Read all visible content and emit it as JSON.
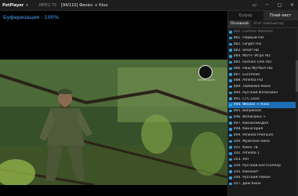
{
  "titlebar": {
    "app_name": "PotPlayer",
    "dropdown_glyph": "▾",
    "format": "MPEG TS",
    "title": "[94/110] Фенікс + Кіно",
    "buttons": [
      "▭",
      "─",
      "□",
      "✕"
    ]
  },
  "video": {
    "buffering": "Буферизация : 100%",
    "channel_logo_text": "ФЕНІКС+КІНО"
  },
  "playlist": {
    "tabs": [
      {
        "label": "Буфер",
        "active": false
      },
      {
        "label": "Плей-лист",
        "active": true
      }
    ],
    "subtabs": [
      {
        "label": "Основной",
        "active": true
      },
      {
        "label": "Этот компьютер",
        "active": false
      }
    ],
    "items": [
      {
        "label": "080. Cartoon Network",
        "state": "dim"
      },
      {
        "label": "081. Первый HD",
        "state": "normal"
      },
      {
        "label": "082. Ginger HD",
        "state": "normal"
      },
      {
        "label": "083. SHOP HD",
        "state": "normal"
      },
      {
        "label": "084. Матч! Игра HD",
        "state": "normal"
      },
      {
        "label": "085. Fashion One HD",
        "state": "normal"
      },
      {
        "label": "086. Наш Футбол HD",
        "state": "normal"
      },
      {
        "label": "087. Euronews",
        "state": "normal"
      },
      {
        "label": "088. Amedia HD",
        "state": "normal"
      },
      {
        "label": "089. Любимое Кино",
        "state": "normal"
      },
      {
        "label": "090. Русский Иллюзион",
        "state": "normal"
      },
      {
        "label": "091. СТС Love",
        "state": "normal"
      },
      {
        "label": "094. Фенікс + Кіно",
        "state": "selected"
      },
      {
        "label": "095. Bollywood",
        "state": "normal"
      },
      {
        "label": "096. Иллюзион +",
        "state": "normal"
      },
      {
        "label": "097. Кинокомедия",
        "state": "normal"
      },
      {
        "label": "098. Киносерия",
        "state": "normal"
      },
      {
        "label": "099. Amedia Premium",
        "state": "normal"
      },
      {
        "label": "100. Мужское кино",
        "state": "normal"
      },
      {
        "label": "101. Кино ТВ",
        "state": "normal"
      },
      {
        "label": "102. Amedia 1",
        "state": "normal"
      },
      {
        "label": "103. XXI",
        "state": "normal"
      },
      {
        "label": "104. Русский Бестселлер",
        "state": "normal"
      },
      {
        "label": "105. Кинохит",
        "state": "normal"
      },
      {
        "label": "106. Русский Роман",
        "state": "normal"
      },
      {
        "label": "107. Дом Кино",
        "state": "normal"
      }
    ]
  },
  "colors": {
    "accent": "#1c6fb7",
    "buffer_text": "#4aa8ff"
  }
}
